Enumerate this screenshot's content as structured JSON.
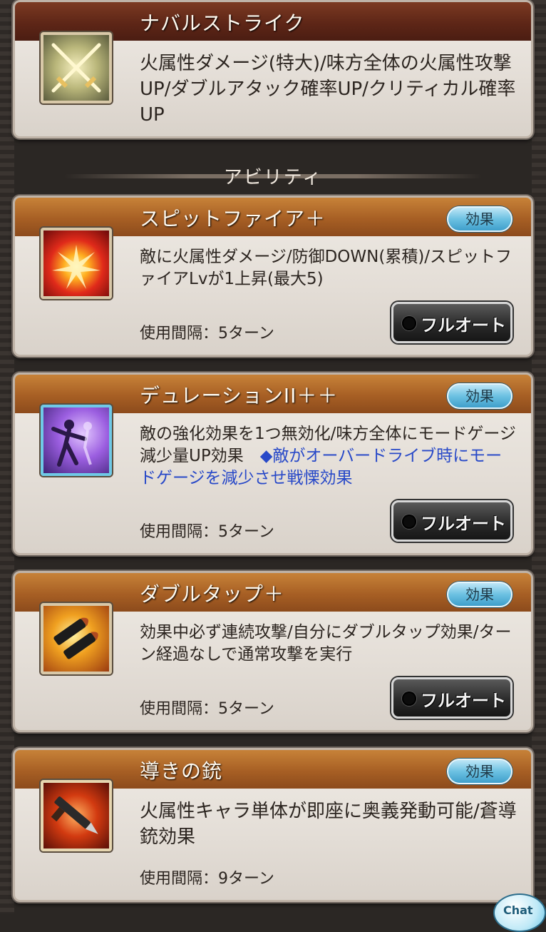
{
  "ougi": {
    "title": "ナバルストライク",
    "description": "火属性ダメージ(特大)/味方全体の火属性攻撃UP/ダブルアタック確率UP/クリティカル確率UP",
    "icon": "crossed-swords-icon"
  },
  "section_title": "アビリティ",
  "abilities": [
    {
      "name": "スピットファイア＋",
      "effect_label": "効果",
      "description": "敵に火属性ダメージ/防御DOWN(累積)/スピットファイアLvが1上昇(最大5)",
      "note": "",
      "interval": "使用間隔：5ターン",
      "fullauto_label": "フルオート",
      "icon": "fire-burst-icon"
    },
    {
      "name": "デュレーションII＋＋",
      "effect_label": "効果",
      "description": "敵の強化効果を1つ無効化/味方全体にモードゲージ減少量UP効果　",
      "note": "◆敵がオーバードライブ時にモードゲージを減少させ戦慄効果",
      "interval": "使用間隔：5ターン",
      "fullauto_label": "フルオート",
      "icon": "dancer-silhouette-icon"
    },
    {
      "name": "ダブルタップ＋",
      "effect_label": "効果",
      "description": "効果中必ず連続攻撃/自分にダブルタップ効果/ターン経過なしで通常攻撃を実行",
      "note": "",
      "interval": "使用間隔：5ターン",
      "fullauto_label": "フルオート",
      "icon": "bullets-icon"
    },
    {
      "name": "導きの銃",
      "effect_label": "効果",
      "description": "火属性キャラ単体が即座に奥義発動可能/蒼導銃効果",
      "note": "",
      "interval": "使用間隔：9ターン",
      "icon": "blade-gun-icon"
    }
  ],
  "chat_label": "Chat",
  "colors": {
    "ougi_header": "#5e2617",
    "ability_header": "#a75f24",
    "effect_button": "#6cc1e2",
    "note_text": "#2849c8"
  }
}
